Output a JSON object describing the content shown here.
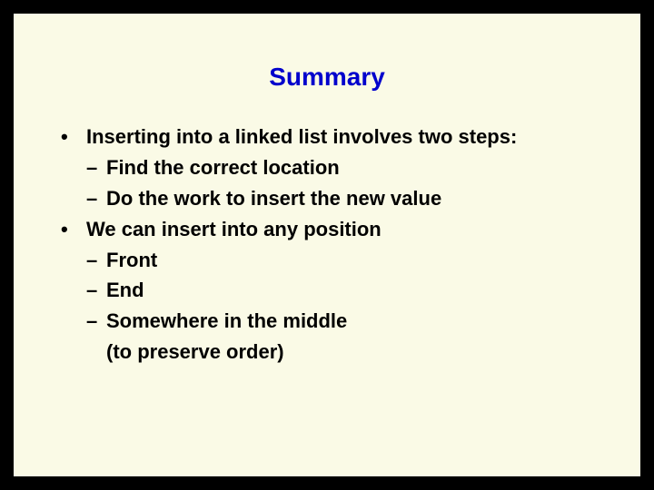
{
  "slide": {
    "title": "Summary",
    "bullets": [
      {
        "text": "Inserting into a linked list involves two steps:",
        "subs": [
          "Find the correct location",
          "Do the work to insert the new value"
        ]
      },
      {
        "text": "We can insert into any position",
        "subs": [
          "Front",
          "End",
          "Somewhere in the middle"
        ],
        "sub_cont": "(to preserve order)"
      }
    ]
  }
}
